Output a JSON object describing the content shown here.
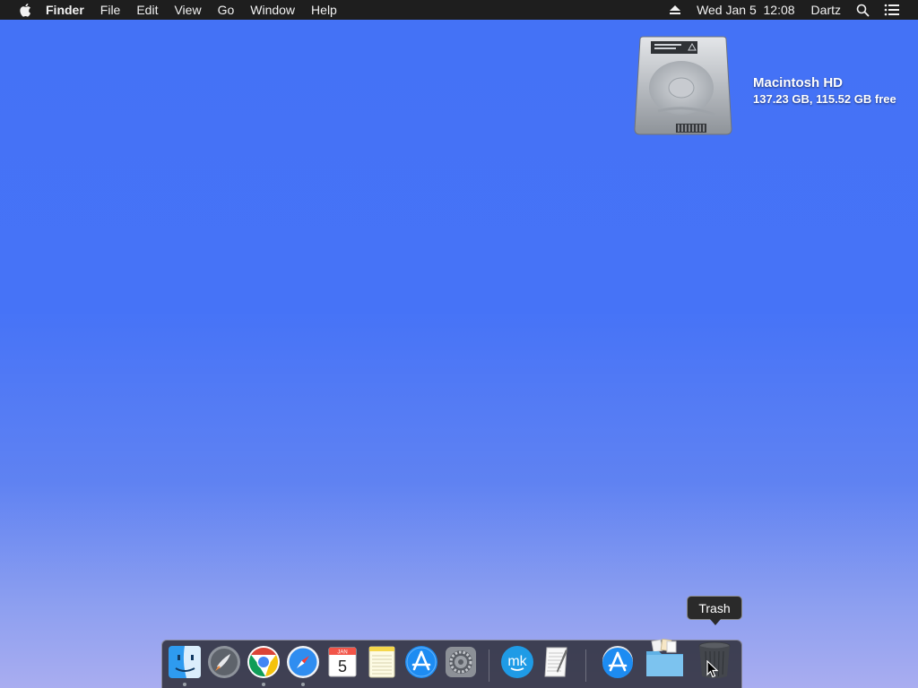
{
  "menubar": {
    "app_name": "Finder",
    "menus": [
      "File",
      "Edit",
      "View",
      "Go",
      "Window",
      "Help"
    ],
    "clock": "Wed Jan 5  12:08",
    "user": "Dartz",
    "icons": [
      "apple-icon",
      "eject-icon",
      "spotlight-search-icon",
      "notification-center-icon"
    ]
  },
  "desktop": {
    "drive": {
      "name": "Macintosh HD",
      "info": "137.23 GB, 115.52 GB free"
    }
  },
  "tooltip": {
    "label": "Trash"
  },
  "dock": {
    "items": [
      {
        "name": "Finder",
        "icon": "finder-icon",
        "running": true
      },
      {
        "name": "Launchpad",
        "icon": "launchpad-icon",
        "running": false
      },
      {
        "name": "Google Chrome",
        "icon": "chrome-icon",
        "running": true
      },
      {
        "name": "Safari",
        "icon": "safari-icon",
        "running": true
      },
      {
        "name": "Calendar",
        "icon": "calendar-icon",
        "running": false,
        "month": "JAN",
        "day": "5"
      },
      {
        "name": "Notes",
        "icon": "notes-icon",
        "running": false
      },
      {
        "name": "App Store",
        "icon": "app-store-icon",
        "running": false
      },
      {
        "name": "System Preferences",
        "icon": "system-preferences-icon",
        "running": false
      },
      {
        "name": "MK",
        "icon": "mk-app-icon",
        "running": false,
        "text": "mk"
      },
      {
        "name": "TextEdit",
        "icon": "textedit-icon",
        "running": false
      },
      {
        "name": "Applications",
        "icon": "app-store-stack-icon",
        "running": false
      },
      {
        "name": "Downloads",
        "icon": "downloads-folder-icon",
        "running": false
      },
      {
        "name": "Trash",
        "icon": "trash-icon",
        "running": false
      }
    ]
  },
  "colors": {
    "wallpaper_top": "#4472f6",
    "wallpaper_bottom": "#a9adf0",
    "menubar": "#1e1e1e"
  }
}
